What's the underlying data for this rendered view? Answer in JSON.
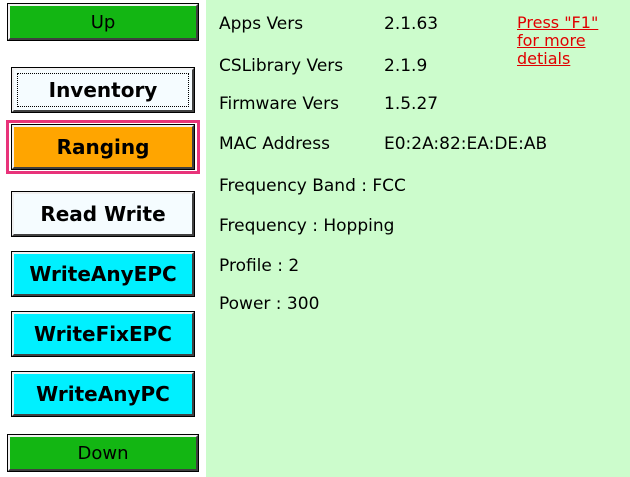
{
  "buttons": {
    "up": "Up",
    "inventory": "Inventory",
    "ranging": "Ranging",
    "read_write": "Read Write",
    "write_any_epc": "WriteAnyEPC",
    "write_fix_epc": "WriteFixEPC",
    "write_any_pc": "WriteAnyPC",
    "down": "Down"
  },
  "info": {
    "apps_vers_label": "Apps Vers",
    "apps_vers_value": "2.1.63",
    "cslibrary_vers_label": "CSLibrary Vers",
    "cslibrary_vers_value": "2.1.9",
    "firmware_vers_label": "Firmware Vers",
    "firmware_vers_value": "1.5.27",
    "mac_address_label": "MAC Address",
    "mac_address_value": "E0:2A:82:EA:DE:AB",
    "frequency_band": "Frequency Band : FCC",
    "frequency": "Frequency : Hopping",
    "profile": "Profile : 2",
    "power": "Power : 300"
  },
  "help": {
    "line1": "Press \"F1\"",
    "line2": "for more",
    "line3": "detials"
  },
  "colors": {
    "nav_button": "#13b613",
    "info_background": "#ccfccc",
    "ranging_button": "#ffa500",
    "cyan_button": "#00f0ff",
    "help_link": "#e00000",
    "selection_highlight": "#e8337a"
  }
}
